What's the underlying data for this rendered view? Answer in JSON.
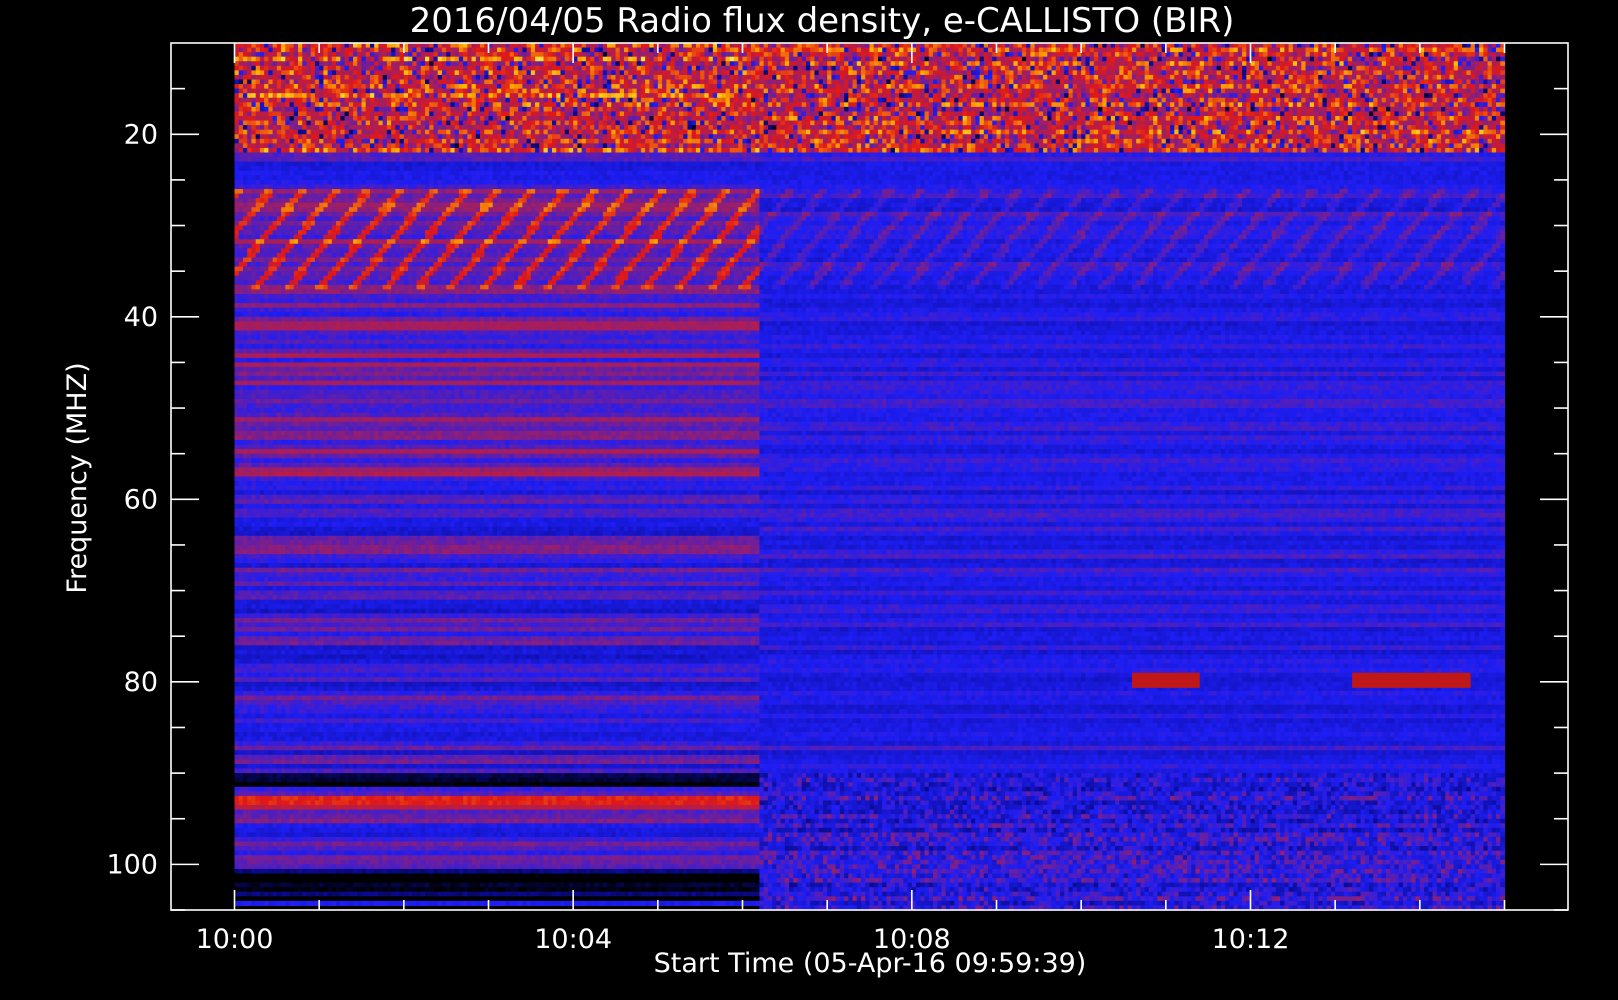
{
  "chart_data": {
    "type": "heatmap",
    "title": "2016/04/05  Radio flux density, e-CALLISTO (BIR)",
    "xlabel": "Start Time (05-Apr-16 09:59:39)",
    "ylabel": "Frequency (MHZ)",
    "x_tick_labels": [
      "10:00",
      "10:04",
      "10:08",
      "10:12"
    ],
    "x_tick_minutes": [
      0,
      4,
      8,
      12
    ],
    "x_minor_step_minutes": 1,
    "y_tick_labels": [
      "20",
      "40",
      "60",
      "80",
      "100"
    ],
    "y_tick_values": [
      20,
      40,
      60,
      80,
      100
    ],
    "y_minor_step": 5,
    "y_reversed": true,
    "xlim_minutes": [
      -0.75,
      15.75
    ],
    "ylim": [
      105,
      10
    ],
    "data_extent": {
      "x_minutes": [
        0,
        15
      ],
      "freq_mhz": [
        10,
        105
      ]
    },
    "colormap": [
      "#000000",
      "#0a0a90",
      "#1e1ef5",
      "#9a1f6a",
      "#e01818",
      "#ffb000",
      "#ffff60"
    ],
    "features": [
      {
        "name": "interference-band",
        "freq_mhz": [
          10,
          22
        ],
        "time_minutes": [
          0,
          15
        ],
        "intensity": "high"
      },
      {
        "name": "drifting-bursts",
        "freq_mhz": [
          26,
          37
        ],
        "time_minutes": [
          0,
          6.2
        ],
        "intensity": "medium-high"
      },
      {
        "name": "faint-drifting-bursts",
        "freq_mhz": [
          26,
          40
        ],
        "time_minutes": [
          6.2,
          15
        ],
        "intensity": "low"
      },
      {
        "name": "band-80mhz",
        "freq_mhz": [
          79,
          80
        ],
        "time_minutes": [
          10.6,
          11.4
        ],
        "intensity": "medium"
      },
      {
        "name": "band-80mhz-late",
        "freq_mhz": [
          79,
          80
        ],
        "time_minutes": [
          13.2,
          14.6
        ],
        "intensity": "medium"
      },
      {
        "name": "band-93mhz",
        "freq_mhz": [
          92.5,
          94
        ],
        "time_minutes": [
          0,
          6.2
        ],
        "intensity": "medium-high"
      }
    ]
  }
}
